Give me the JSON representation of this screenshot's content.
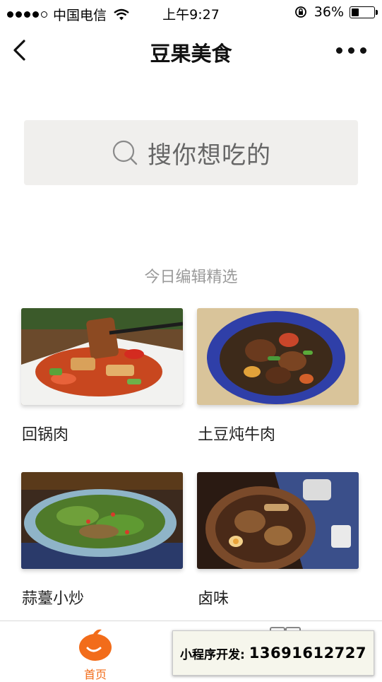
{
  "status_bar": {
    "carrier": "中国电信",
    "time": "上午9:27",
    "battery_text": "36%",
    "battery_level": 0.36
  },
  "nav": {
    "title": "豆果美食"
  },
  "search": {
    "placeholder": "搜你想吃的"
  },
  "section": {
    "title": "今日编辑精选"
  },
  "recipes": [
    {
      "name": "回锅肉"
    },
    {
      "name": "土豆炖牛肉"
    },
    {
      "name": "蒜薹小炒"
    },
    {
      "name": "卤味"
    }
  ],
  "tabbar": {
    "home_label": "首页"
  },
  "banner": {
    "label": "小程序开发:",
    "phone": "13691612727"
  },
  "colors": {
    "accent": "#f26c1a",
    "search_bg": "#f0efed"
  }
}
